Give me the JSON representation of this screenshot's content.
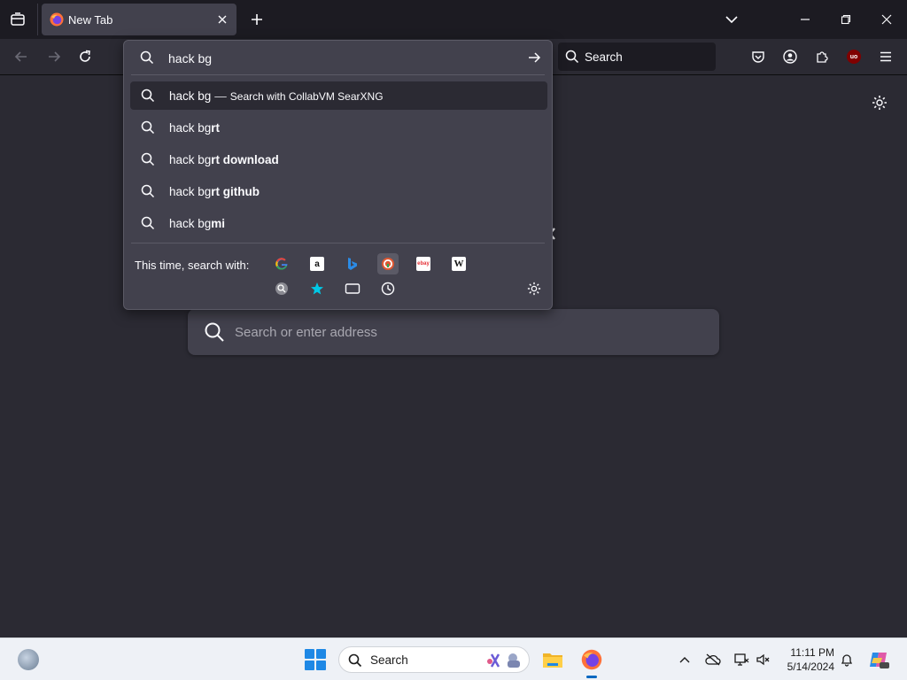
{
  "tabstrip": {
    "tabs": [
      {
        "title": "New Tab",
        "favicon": "firefox-icon"
      }
    ]
  },
  "navbar": {
    "search_placeholder": "Search"
  },
  "urlbar": {
    "input_value": "hack bg",
    "suggestions": [
      {
        "typed": "hack bg",
        "completion": "",
        "action": "Search with CollabVM SearXNG",
        "selected": true
      },
      {
        "typed": "hack bg",
        "completion": "rt",
        "action": "",
        "selected": false
      },
      {
        "typed": "hack bg",
        "completion": "rt download",
        "action": "",
        "selected": false
      },
      {
        "typed": "hack bg",
        "completion": "rt github",
        "action": "",
        "selected": false
      },
      {
        "typed": "hack bg",
        "completion": "mi",
        "action": "",
        "selected": false
      }
    ],
    "one_off_label": "This time, search with:",
    "engines": [
      "google-icon",
      "amazon-icon",
      "bing-icon",
      "duckduckgo-icon",
      "ebay-icon",
      "wikipedia-icon",
      "searxng-icon"
    ],
    "local_sources": [
      "bookmarks-icon",
      "tabs-icon",
      "history-icon"
    ]
  },
  "content": {
    "search_placeholder": "Search or enter address"
  },
  "taskbar": {
    "search_placeholder": "Search",
    "time": "11:11 PM",
    "date": "5/14/2024"
  },
  "colors": {
    "chrome_dark": "#1c1b22",
    "content_bg": "#2b2a33",
    "popup_bg": "#42414d",
    "taskbar_bg": "#eef1f6",
    "windows_blue": "#1e88e5"
  }
}
